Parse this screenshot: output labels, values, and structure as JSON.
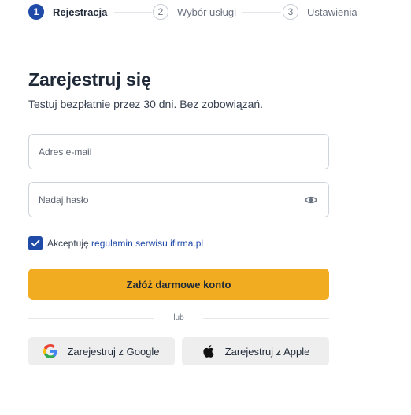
{
  "stepper": {
    "steps": [
      {
        "number": "1",
        "label": "Rejestracja",
        "state": "active"
      },
      {
        "number": "2",
        "label": "Wybór usługi",
        "state": "inactive"
      },
      {
        "number": "3",
        "label": "Ustawienia",
        "state": "inactive"
      }
    ]
  },
  "form": {
    "title": "Zarejestruj się",
    "subtitle": "Testuj bezpłatnie przez 30 dni. Bez zobowiązań.",
    "email": {
      "placeholder": "Adres e-mail",
      "value": ""
    },
    "password": {
      "placeholder": "Nadaj hasło",
      "value": ""
    },
    "terms": {
      "checked": true,
      "text_before": "Akceptuję ",
      "link_text": "regulamin serwisu ifirma.pl"
    },
    "submit_label": "Załóż darmowe konto",
    "divider_label": "lub",
    "google_label": "Zarejestruj z Google",
    "apple_label": "Zarejestruj z Apple"
  },
  "colors": {
    "accent": "#1f4aa8",
    "primary_button": "#f2ac22",
    "social_button": "#eeeeee"
  },
  "icons": {
    "password_toggle": "eye-icon",
    "checkbox": "checkmark-icon",
    "google": "google-logo-icon",
    "apple": "apple-logo-icon"
  }
}
